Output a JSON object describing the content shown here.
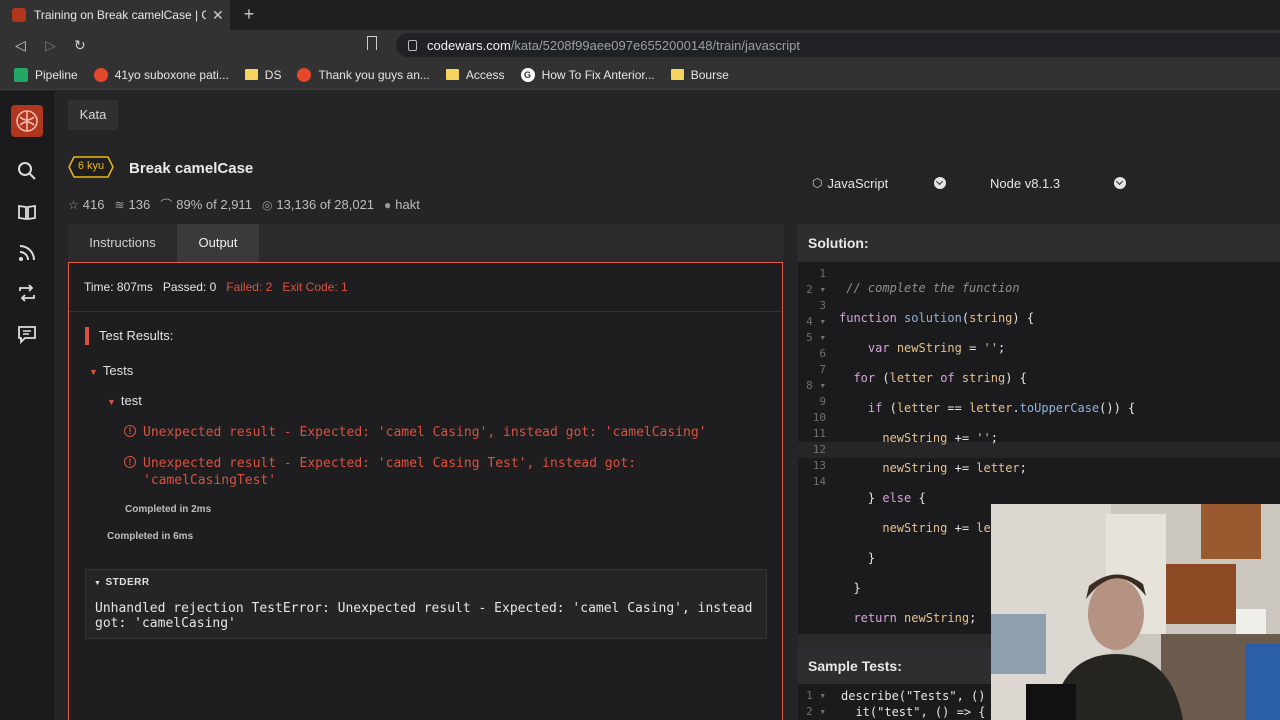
{
  "browser": {
    "tab_title": "Training on Break camelCase | Co",
    "url_domain": "codewars.com",
    "url_path": "/kata/5208f99aee097e6552000148/train/javascript",
    "bookmarks": [
      {
        "label": "Pipeline",
        "icon": "sheets-icon"
      },
      {
        "label": "41yo suboxone pati...",
        "icon": "reddit-icon"
      },
      {
        "label": "DS",
        "icon": "folder-icon"
      },
      {
        "label": "Thank you guys an...",
        "icon": "reddit-icon"
      },
      {
        "label": "Access",
        "icon": "folder-icon"
      },
      {
        "label": "How To Fix Anterior...",
        "icon": "google-icon"
      },
      {
        "label": "Bourse",
        "icon": "folder-icon"
      }
    ]
  },
  "breadcrumb": "Kata",
  "kata": {
    "rank": "6 kyu",
    "title": "Break camelCase",
    "stats": {
      "stars": "416",
      "collections": "136",
      "satisfaction": "89%",
      "satisfaction_of": "of 2,911",
      "completed": "13,136",
      "completed_of": "of 28,021",
      "author": "hakt"
    }
  },
  "tabs": {
    "instructions": "Instructions",
    "output": "Output"
  },
  "output": {
    "time": "Time: 807ms",
    "passed": "Passed: 0",
    "failed": "Failed: 2",
    "exit_code": "Exit Code: 1",
    "results_heading": "Test Results:",
    "group": "Tests",
    "test": "test",
    "errors": [
      "Unexpected result - Expected: 'camel Casing', instead got: 'camelCasing'",
      "Unexpected result - Expected: 'camel Casing Test', instead got: 'camelCasingTest'"
    ],
    "completed_inner": "Completed in 2ms",
    "completed_outer": "Completed in 6ms",
    "stderr_label": "STDERR",
    "stderr_text": "Unhandled rejection TestError: Unexpected result - Expected: 'camel Casing', instead got: 'camelCasing'"
  },
  "language": {
    "label": "JavaScript",
    "version": "Node v8.1.3"
  },
  "solution_heading": "Solution:",
  "sample_heading": "Sample Tests:",
  "sample_code": [
    "describe(\"Tests\", ()",
    "  it(\"test\", () => {"
  ],
  "colors": {
    "accent": "#b1361e",
    "error": "#d9523f",
    "rank": "#ecb613"
  }
}
